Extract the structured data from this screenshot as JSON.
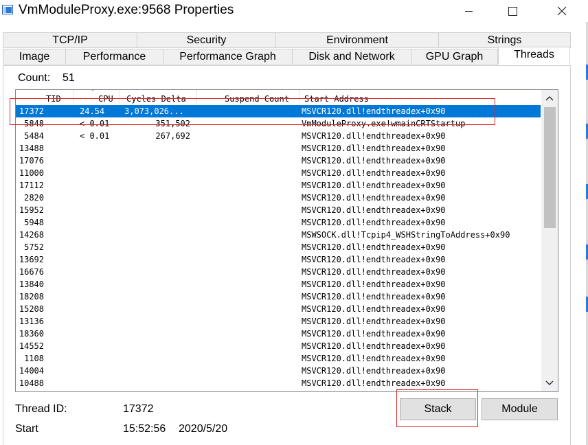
{
  "window": {
    "title": "VmModuleProxy.exe:9568 Properties"
  },
  "tabs": {
    "row1": [
      {
        "label": "TCP/IP"
      },
      {
        "label": "Security"
      },
      {
        "label": "Environment"
      },
      {
        "label": "Strings"
      }
    ],
    "row2": [
      {
        "label": "Image"
      },
      {
        "label": "Performance"
      },
      {
        "label": "Performance Graph"
      },
      {
        "label": "Disk and Network"
      },
      {
        "label": "GPU Graph"
      },
      {
        "label": "Threads",
        "active": true
      }
    ]
  },
  "threads": {
    "count_label": "Count:",
    "count_value": "51",
    "columns": [
      "TID",
      "CPU",
      "Cycles Delta",
      "Suspend Count",
      "Start Address"
    ],
    "sorted_column": "CPU",
    "rows": [
      {
        "tid": "17372",
        "cpu": "24.54",
        "cycles": "3,073,026...",
        "start": "MSVCR120.dll!endthreadex+0x90",
        "selected": true
      },
      {
        "tid": "5848",
        "cpu": "< 0.01",
        "cycles": "351,502",
        "start": "VmModuleProxy.exe!wmainCRTStartup"
      },
      {
        "tid": "5484",
        "cpu": "< 0.01",
        "cycles": "267,692",
        "start": "MSVCR120.dll!endthreadex+0x90"
      },
      {
        "tid": "13488",
        "cpu": "",
        "cycles": "",
        "start": "MSVCR120.dll!endthreadex+0x90"
      },
      {
        "tid": "17076",
        "cpu": "",
        "cycles": "",
        "start": "MSVCR120.dll!endthreadex+0x90"
      },
      {
        "tid": "11000",
        "cpu": "",
        "cycles": "",
        "start": "MSVCR120.dll!endthreadex+0x90"
      },
      {
        "tid": "17112",
        "cpu": "",
        "cycles": "",
        "start": "MSVCR120.dll!endthreadex+0x90"
      },
      {
        "tid": "2820",
        "cpu": "",
        "cycles": "",
        "start": "MSVCR120.dll!endthreadex+0x90"
      },
      {
        "tid": "15952",
        "cpu": "",
        "cycles": "",
        "start": "MSVCR120.dll!endthreadex+0x90"
      },
      {
        "tid": "5948",
        "cpu": "",
        "cycles": "",
        "start": "MSVCR120.dll!endthreadex+0x90"
      },
      {
        "tid": "14268",
        "cpu": "",
        "cycles": "",
        "start": "MSWSOCK.dll!Tcpip4_WSHStringToAddress+0x90"
      },
      {
        "tid": "5752",
        "cpu": "",
        "cycles": "",
        "start": "MSVCR120.dll!endthreadex+0x90"
      },
      {
        "tid": "13692",
        "cpu": "",
        "cycles": "",
        "start": "MSVCR120.dll!endthreadex+0x90"
      },
      {
        "tid": "16676",
        "cpu": "",
        "cycles": "",
        "start": "MSVCR120.dll!endthreadex+0x90"
      },
      {
        "tid": "13840",
        "cpu": "",
        "cycles": "",
        "start": "MSVCR120.dll!endthreadex+0x90"
      },
      {
        "tid": "18208",
        "cpu": "",
        "cycles": "",
        "start": "MSVCR120.dll!endthreadex+0x90"
      },
      {
        "tid": "15208",
        "cpu": "",
        "cycles": "",
        "start": "MSVCR120.dll!endthreadex+0x90"
      },
      {
        "tid": "13136",
        "cpu": "",
        "cycles": "",
        "start": "MSVCR120.dll!endthreadex+0x90"
      },
      {
        "tid": "18360",
        "cpu": "",
        "cycles": "",
        "start": "MSVCR120.dll!endthreadex+0x90"
      },
      {
        "tid": "14552",
        "cpu": "",
        "cycles": "",
        "start": "MSVCR120.dll!endthreadex+0x90"
      },
      {
        "tid": "1108",
        "cpu": "",
        "cycles": "",
        "start": "MSVCR120.dll!endthreadex+0x90"
      },
      {
        "tid": "14004",
        "cpu": "",
        "cycles": "",
        "start": "MSVCR120.dll!endthreadex+0x90"
      },
      {
        "tid": "10488",
        "cpu": "",
        "cycles": "",
        "start": "MSVCR120.dll!endthreadex+0x90"
      }
    ]
  },
  "details": {
    "thread_id_label": "Thread ID:",
    "thread_id_value": "17372",
    "start_label": "Start",
    "start_time": "15:52:56",
    "start_date": "2020/5/20"
  },
  "buttons": {
    "stack": "Stack",
    "module": "Module"
  },
  "icons": {
    "app": "app-window-icon",
    "minimize": "minimize-icon",
    "maximize": "maximize-icon",
    "close": "close-icon",
    "scroll_up": "chevron-up-icon",
    "scroll_down": "chevron-down-icon"
  },
  "colors": {
    "selection": "#0078d7",
    "annotation": "#e0242b"
  }
}
